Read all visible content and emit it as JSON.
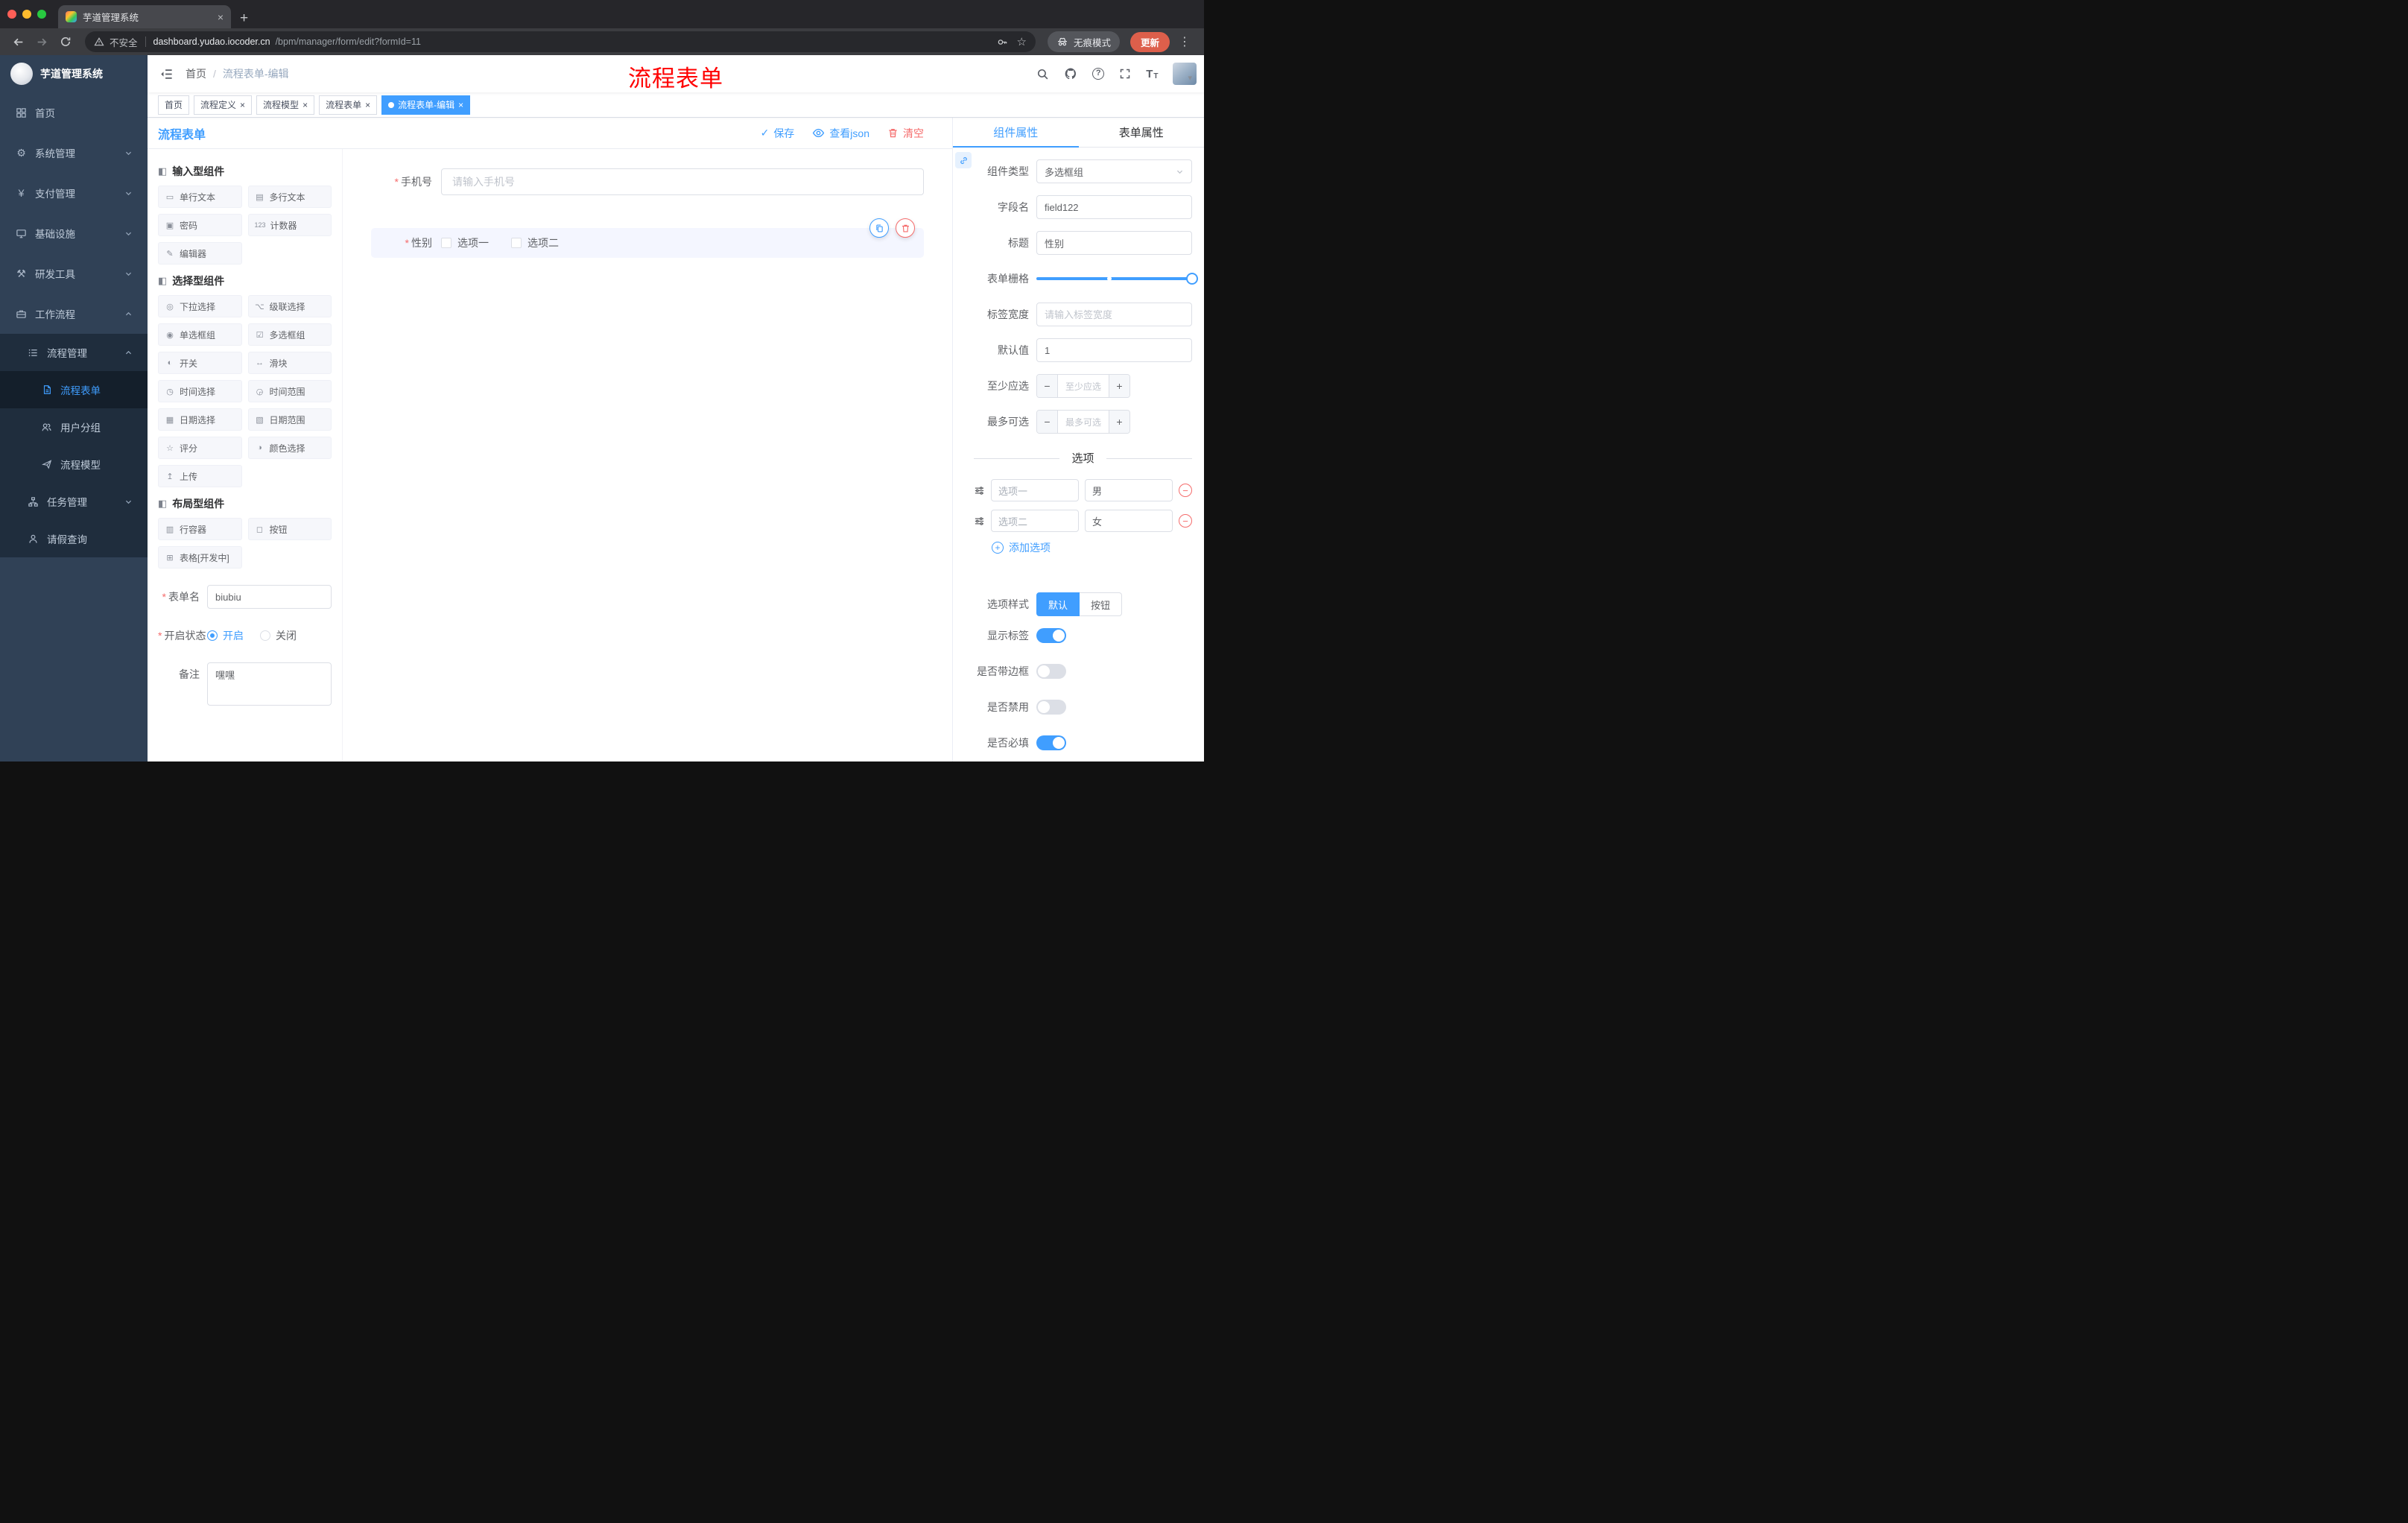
{
  "icons": {
    "close": "×",
    "plus": "+",
    "dots": "⋮",
    "star": "☆",
    "help": "?",
    "check": "✓",
    "minus": "−",
    "plus_small": "+",
    "group": "◧",
    "font_size": "T",
    "caret_down": "▾"
  },
  "browser": {
    "tab_title": "芋道管理系统",
    "security_label": "不安全",
    "url_host": "dashboard.yudao.iocoder.cn",
    "url_path": "/bpm/manager/form/edit?formId=11",
    "incognito_label": "无痕模式",
    "update_label": "更新"
  },
  "sidebar": {
    "logo_title": "芋道管理系统",
    "items": [
      {
        "label": "首页"
      },
      {
        "label": "系统管理",
        "expandable": true
      },
      {
        "label": "支付管理",
        "expandable": true
      },
      {
        "label": "基础设施",
        "expandable": true
      },
      {
        "label": "研发工具",
        "expandable": true
      },
      {
        "label": "工作流程",
        "expandable": true,
        "expanded": true
      },
      {
        "label": "流程管理",
        "expandable": true,
        "expanded": true
      },
      {
        "label": "流程表单",
        "active": true
      },
      {
        "label": "用户分组"
      },
      {
        "label": "流程模型"
      },
      {
        "label": "任务管理",
        "expandable": true
      },
      {
        "label": "请假查询"
      }
    ]
  },
  "header": {
    "breadcrumb_root": "首页",
    "breadcrumb_sep": "/",
    "breadcrumb_current": "流程表单-编辑",
    "annotation": "流程表单"
  },
  "tags": [
    {
      "label": "首页",
      "closable": false,
      "active": false
    },
    {
      "label": "流程定义",
      "closable": true,
      "active": false
    },
    {
      "label": "流程模型",
      "closable": true,
      "active": false
    },
    {
      "label": "流程表单",
      "closable": true,
      "active": false
    },
    {
      "label": "流程表单-编辑",
      "closable": true,
      "active": true
    }
  ],
  "designer": {
    "title": "流程表单",
    "save_label": "保存",
    "view_json_label": "查看json",
    "clear_label": "清空"
  },
  "palette": {
    "groups": [
      {
        "title": "输入型组件",
        "items": [
          {
            "label": "单行文本",
            "icon": "▭"
          },
          {
            "label": "多行文本",
            "icon": "▤"
          },
          {
            "label": "密码",
            "icon": "▣"
          },
          {
            "label": "计数器",
            "icon": "123"
          },
          {
            "label": "编辑器",
            "icon": "✎"
          }
        ]
      },
      {
        "title": "选择型组件",
        "items": [
          {
            "label": "下拉选择",
            "icon": "◎"
          },
          {
            "label": "级联选择",
            "icon": "⌥"
          },
          {
            "label": "单选框组",
            "icon": "◉"
          },
          {
            "label": "多选框组",
            "icon": "☑"
          },
          {
            "label": "开关",
            "icon": "◐"
          },
          {
            "label": "滑块",
            "icon": "↔"
          },
          {
            "label": "时间选择",
            "icon": "◷"
          },
          {
            "label": "时间范围",
            "icon": "◶"
          },
          {
            "label": "日期选择",
            "icon": "▦"
          },
          {
            "label": "日期范围",
            "icon": "▧"
          },
          {
            "label": "评分",
            "icon": "☆"
          },
          {
            "label": "颜色选择",
            "icon": "◑"
          },
          {
            "label": "上传",
            "icon": "↥"
          }
        ]
      },
      {
        "title": "布局型组件",
        "items": [
          {
            "label": "行容器",
            "icon": "▥"
          },
          {
            "label": "按钮",
            "icon": "◻"
          },
          {
            "label": "表格[开发中]",
            "icon": "⊞"
          }
        ]
      }
    ],
    "meta": {
      "name_label": "表单名",
      "name_value": "biubiu",
      "status_label": "开启状态",
      "status_on": "开启",
      "status_off": "关闭",
      "status_value": "开启",
      "remark_label": "备注",
      "remark_value": "嘿嘿"
    }
  },
  "canvas": {
    "phone_label": "手机号",
    "phone_placeholder": "请输入手机号",
    "gender_label": "性别",
    "gender_options": [
      {
        "label": "选项一",
        "checked": false
      },
      {
        "label": "选项二",
        "checked": false
      }
    ]
  },
  "inspector": {
    "tab_component": "组件属性",
    "tab_form": "表单属性",
    "active_tab": "组件属性",
    "component_type_label": "组件类型",
    "component_type_value": "多选框组",
    "field_name_label": "字段名",
    "field_name_value": "field122",
    "title_label": "标题",
    "title_value": "性别",
    "grid_label": "表单栅格",
    "label_width_label": "标签宽度",
    "label_width_placeholder": "请输入标签宽度",
    "default_label": "默认值",
    "default_value": "1",
    "min_label": "至少应选",
    "min_placeholder": "至少应选",
    "max_label": "最多可选",
    "max_placeholder": "最多可选",
    "options_divider": "选项",
    "option_rows": [
      {
        "name": "选项一",
        "value": "男"
      },
      {
        "name": "选项二",
        "value": "女"
      }
    ],
    "add_option_label": "添加选项",
    "option_style_label": "选项样式",
    "option_style_default": "默认",
    "option_style_button": "按钮",
    "option_style_value": "默认",
    "switches": [
      {
        "label": "显示标签",
        "on": true
      },
      {
        "label": "是否带边框",
        "on": false
      },
      {
        "label": "是否禁用",
        "on": false
      },
      {
        "label": "是否必填",
        "on": true
      }
    ]
  },
  "colors": {
    "accent": "#409eff",
    "danger": "#f56c6c",
    "sidebar_bg": "#304156",
    "submenu_bg": "#1f2d3d",
    "tag_active_bg": "#409eff",
    "update_button_bg": "#dd5f4b",
    "annotation_color": "#ff0000"
  }
}
